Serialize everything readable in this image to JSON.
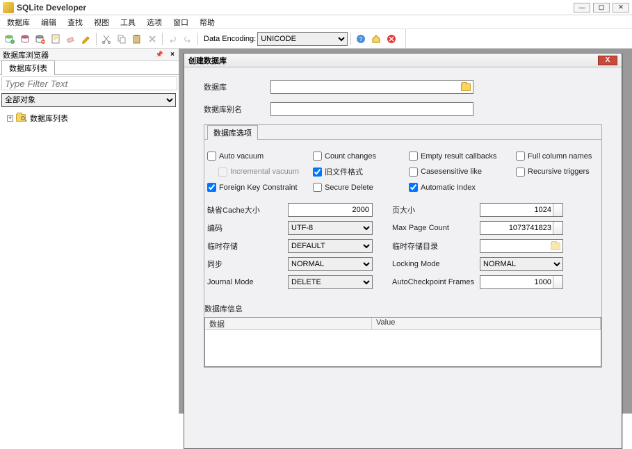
{
  "app_title": "SQLite Developer",
  "menubar": [
    "数据库",
    "编辑",
    "查找",
    "视图",
    "工具",
    "选项",
    "窗口",
    "帮助"
  ],
  "toolbar": {
    "encoding_label": "Data Encoding:",
    "encoding_value": "UNICODE"
  },
  "browser": {
    "panel_title": "数据库浏览器",
    "tab": "数据库列表",
    "filter_placeholder": "Type Filter Text",
    "scope_value": "全部对象",
    "tree_root": "数据库列表"
  },
  "dialog": {
    "title": "创建数据库",
    "labels": {
      "database": "数据库",
      "alias": "数据库别名",
      "options_tab": "数据库选项",
      "auto_vacuum": "Auto vacuum",
      "incremental_vacuum": "Incremental vacuum",
      "foreign_key": "Foreign Key Constraint",
      "count_changes": "Count changes",
      "old_format": "旧文件格式",
      "secure_delete": "Secure Delete",
      "empty_callbacks": "Empty result callbacks",
      "casesensitive": "Casesensitive like",
      "auto_index": "Automatic Index",
      "full_column": "Full column names",
      "recursive_triggers": "Recursive triggers",
      "cache_size": "缺省Cache大小",
      "encoding": "编码",
      "temp_store": "临时存储",
      "sync": "同步",
      "journal_mode": "Journal Mode",
      "page_size": "页大小",
      "max_page_count": "Max Page Count",
      "temp_dir": "临时存储目录",
      "locking_mode": "Locking Mode",
      "auto_checkpoint": "AutoCheckpoint Frames",
      "info_section": "数据库信息",
      "col_data": "数据",
      "col_value": "Value"
    },
    "values": {
      "database": "",
      "alias": "",
      "auto_vacuum": false,
      "incremental_vacuum": false,
      "foreign_key": true,
      "count_changes": false,
      "old_format": true,
      "secure_delete": false,
      "empty_callbacks": false,
      "casesensitive": false,
      "auto_index": true,
      "full_column": false,
      "recursive_triggers": false,
      "cache_size": "2000",
      "encoding": "UTF-8",
      "temp_store": "DEFAULT",
      "sync": "NORMAL",
      "journal_mode": "DELETE",
      "page_size": "1024",
      "max_page_count": "1073741823",
      "temp_dir": "",
      "locking_mode": "NORMAL",
      "auto_checkpoint": "1000"
    }
  }
}
